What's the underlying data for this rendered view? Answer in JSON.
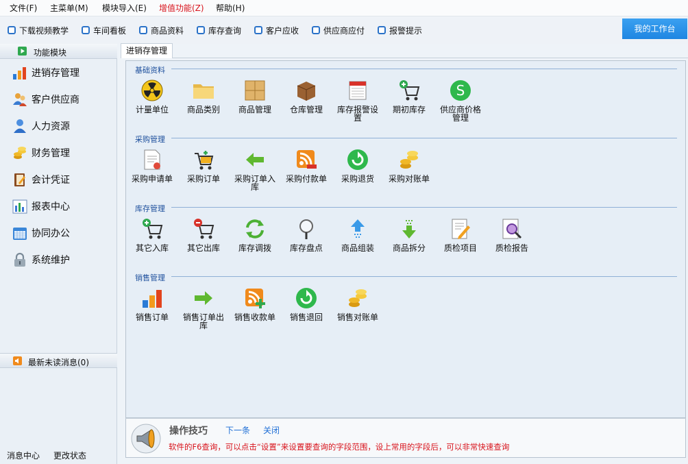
{
  "menu": {
    "file": "文件(F)",
    "main": "主菜单(M)",
    "import": "模块导入(E)",
    "value_added": "增值功能(Z)",
    "help": "帮助(H)"
  },
  "toolbar": {
    "items": [
      "下载视频教学",
      "车间看板",
      "商品资料",
      "库存查询",
      "客户应收",
      "供应商应付",
      "报警提示"
    ],
    "workbench": "我的工作台"
  },
  "sidebar": {
    "header": "功能模块",
    "items": [
      "进销存管理",
      "客户供应商",
      "人力资源",
      "财务管理",
      "会计凭证",
      "报表中心",
      "协同办公",
      "系统维护"
    ],
    "messages": "最新未读消息(0)",
    "footer_left": "消息中心",
    "footer_right": "更改状态"
  },
  "tab": {
    "active": "进销存管理"
  },
  "sections": [
    {
      "title": "基础资料",
      "items": [
        "计量单位",
        "商品类别",
        "商品管理",
        "仓库管理",
        "库存报警设置",
        "期初库存",
        "供应商价格管理"
      ]
    },
    {
      "title": "采购管理",
      "items": [
        "采购申请单",
        "采购订单",
        "采购订单入库",
        "采购付款单",
        "采购退货",
        "采购对账单"
      ]
    },
    {
      "title": "库存管理",
      "items": [
        "其它入库",
        "其它出库",
        "库存调拨",
        "库存盘点",
        "商品组装",
        "商品拆分",
        "质检项目",
        "质检报告"
      ]
    },
    {
      "title": "销售管理",
      "items": [
        "销售订单",
        "销售订单出库",
        "销售收款单",
        "销售退回",
        "销售对账单"
      ]
    }
  ],
  "tips": {
    "title": "操作技巧",
    "next": "下一条",
    "close": "关闭",
    "text": "软件的F6查询，可以点击“设置”来设置要查询的字段范围，设上常用的字段后，可以非常快速查询"
  },
  "colors": {
    "accent": "#1f86e2",
    "menu_highlight": "#d8141c",
    "section_title": "#1d4f9c",
    "tip_text": "#d8141c"
  }
}
